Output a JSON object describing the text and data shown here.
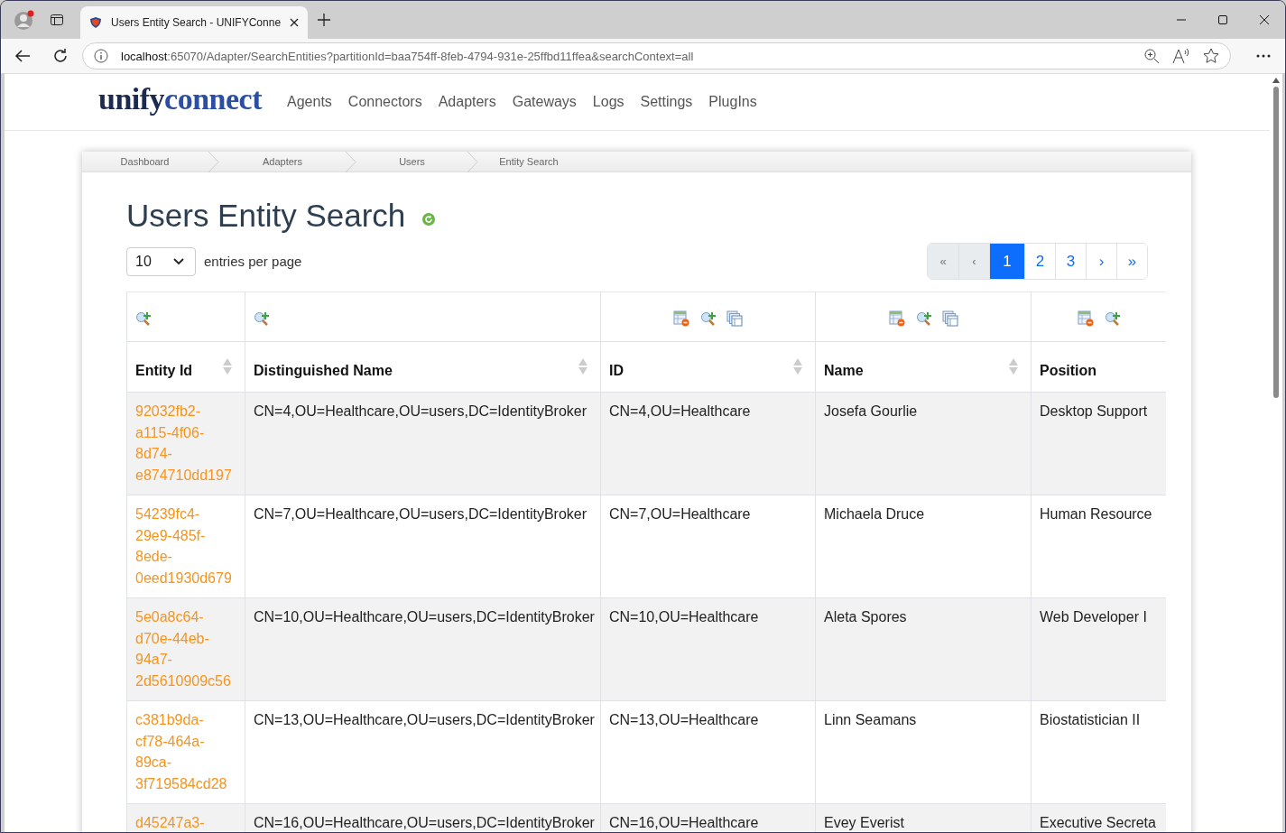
{
  "browser": {
    "tab_title": "Users Entity Search - UNIFYConne",
    "url_host": "localhost",
    "url_rest": ":65070/Adapter/SearchEntities?partitionId=baa754ff-8feb-4794-931e-25ffbd11ffea&searchContext=all"
  },
  "logo": {
    "part_1": "unify",
    "part_2": "connect"
  },
  "nav": [
    "Agents",
    "Connectors",
    "Adapters",
    "Gateways",
    "Logs",
    "Settings",
    "PlugIns"
  ],
  "breadcrumb": [
    "Dashboard",
    "Adapters",
    "Users",
    "Entity Search"
  ],
  "title": "Users Entity Search",
  "page_size": {
    "value": "10",
    "label": "entries per page"
  },
  "pagination": [
    {
      "label": "«",
      "disabled": true,
      "selected": false
    },
    {
      "label": "‹",
      "disabled": true,
      "selected": false
    },
    {
      "label": "1",
      "disabled": false,
      "selected": true
    },
    {
      "label": "2",
      "disabled": false,
      "selected": false
    },
    {
      "label": "3",
      "disabled": false,
      "selected": false
    },
    {
      "label": "›",
      "disabled": false,
      "selected": false
    },
    {
      "label": "»",
      "disabled": false,
      "selected": false
    }
  ],
  "table": {
    "columns": [
      {
        "name": "Entity Id",
        "tools": [
          {
            "kind": "filter"
          }
        ],
        "sort_arrows": true
      },
      {
        "name": "Distinguished Name",
        "tools": [
          {
            "kind": "filter"
          }
        ],
        "sort_arrows": true
      },
      {
        "name": "ID",
        "tools": [
          {
            "kind": "remove"
          },
          {
            "kind": "filter"
          },
          {
            "kind": "copy"
          }
        ],
        "sort_arrows": true
      },
      {
        "name": "Name",
        "tools": [
          {
            "kind": "remove"
          },
          {
            "kind": "filter"
          },
          {
            "kind": "copy"
          }
        ],
        "sort_arrows": true
      },
      {
        "name": "Position",
        "tools": [
          {
            "kind": "remove"
          },
          {
            "kind": "filter"
          }
        ],
        "sort_arrows": false
      }
    ],
    "rows": [
      {
        "entity_id": "92032fb2-a115-4f06-8d74-e874710dd197",
        "distinguished_name": "CN=4,OU=Healthcare,OU=users,DC=IdentityBroker",
        "id": "CN=4,OU=Healthcare",
        "name": "Josefa Gourlie",
        "position": "Desktop Support"
      },
      {
        "entity_id": "54239fc4-29e9-485f-8ede-0eed1930d679",
        "distinguished_name": "CN=7,OU=Healthcare,OU=users,DC=IdentityBroker",
        "id": "CN=7,OU=Healthcare",
        "name": "Michaela Druce",
        "position": "Human Resource"
      },
      {
        "entity_id": "5e0a8c64-d70e-44eb-94a7-2d5610909c56",
        "distinguished_name": "CN=10,OU=Healthcare,OU=users,DC=IdentityBroker",
        "id": "CN=10,OU=Healthcare",
        "name": "Aleta Spores",
        "position": "Web Developer I"
      },
      {
        "entity_id": "c381b9da-cf78-464a-89ca-3f719584cd28",
        "distinguished_name": "CN=13,OU=Healthcare,OU=users,DC=IdentityBroker",
        "id": "CN=13,OU=Healthcare",
        "name": "Linn Seamans",
        "position": "Biostatistician II"
      },
      {
        "entity_id": "d45247a3-",
        "distinguished_name": "CN=16,OU=Healthcare,OU=users,DC=IdentityBroker",
        "id": "CN=16,OU=Healthcare",
        "name": "Evey Everist",
        "position": "Executive Secreta"
      }
    ]
  }
}
